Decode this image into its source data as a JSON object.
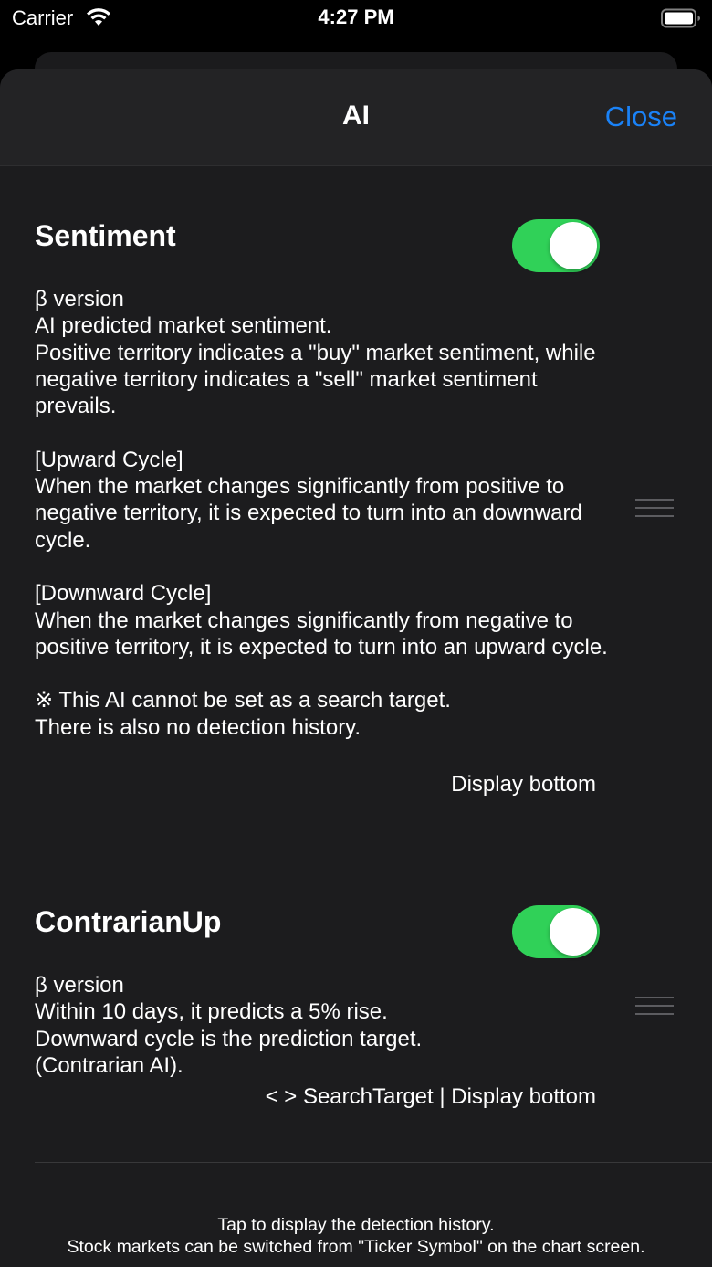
{
  "status_bar": {
    "carrier": "Carrier",
    "time": "4:27 PM"
  },
  "nav": {
    "title": "AI",
    "close_label": "Close"
  },
  "colors": {
    "accent": "#1a82f7",
    "toggle_on": "#30d158",
    "background": "#1c1c1e"
  },
  "items": [
    {
      "title": "Sentiment",
      "enabled": true,
      "description": "β version\nAI predicted market sentiment.\nPositive territory indicates a \"buy\" market sentiment, while negative territory indicates a \"sell\" market sentiment prevails.\n\n[Upward Cycle]\nWhen the market changes significantly from positive to negative territory, it is expected to turn into an downward cycle.\n\n[Downward Cycle]\nWhen the market changes significantly from negative to positive territory, it is expected to turn into an upward cycle.\n\n※ This AI cannot be set as a search target.\nThere is also no detection history.",
      "footer": "Display bottom"
    },
    {
      "title": "ContrarianUp",
      "enabled": true,
      "description": "β version\nWithin 10 days, it predicts a 5% rise.\nDownward cycle is the prediction target.\n(Contrarian AI).",
      "footer": "< > SearchTarget | Display bottom"
    }
  ],
  "footnote": {
    "line1": "Tap to display the detection history.",
    "line2": "Stock markets can be switched from \"Ticker Symbol\" on the chart screen."
  }
}
